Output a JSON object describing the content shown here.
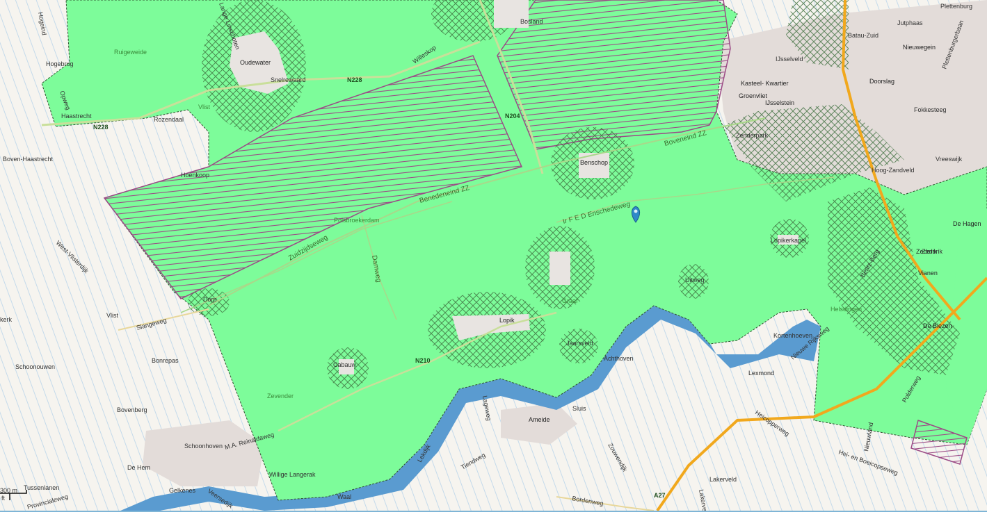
{
  "map": {
    "places": [
      {
        "name": "Hogeind"
      },
      {
        "name": "Hogebrug"
      },
      {
        "name": "Ruigeweide"
      },
      {
        "name": "Oudewater"
      },
      {
        "name": "Snelrewaard"
      },
      {
        "name": "Vlist"
      },
      {
        "name": "Haastrecht"
      },
      {
        "name": "Boven-Haastrecht"
      },
      {
        "name": "Rozendaal"
      },
      {
        "name": "Hoenkoop"
      },
      {
        "name": "Polsbroekerdam"
      },
      {
        "name": "Dorp"
      },
      {
        "name": "Vlist"
      },
      {
        "name": "Bonrepas"
      },
      {
        "name": "Schoonouwen"
      },
      {
        "name": "Bovenberg"
      },
      {
        "name": "Schoonhoven"
      },
      {
        "name": "De Hem"
      },
      {
        "name": "Tussenlanen"
      },
      {
        "name": "Gelkenes"
      },
      {
        "name": "Willige Langerak"
      },
      {
        "name": "Waal"
      },
      {
        "name": "Zevender"
      },
      {
        "name": "Cabauw"
      },
      {
        "name": "Lopik"
      },
      {
        "name": "Graaf"
      },
      {
        "name": "Jaarsveld"
      },
      {
        "name": "Benschop"
      },
      {
        "name": "Uitweg"
      },
      {
        "name": "Lopikerkapel"
      },
      {
        "name": "Achthoven"
      },
      {
        "name": "Ameide"
      },
      {
        "name": "Sluis"
      },
      {
        "name": "Lexmond"
      },
      {
        "name": "Kortenhoeven"
      },
      {
        "name": "Lakerveld"
      },
      {
        "name": "Helsdingen"
      },
      {
        "name": "Vianen"
      },
      {
        "name": "De Biezen"
      },
      {
        "name": "Zederik"
      },
      {
        "name": "De Hagen"
      },
      {
        "name": "Hoog-Zandveld"
      },
      {
        "name": "Vreeswijk"
      },
      {
        "name": "Zenderpark"
      },
      {
        "name": "IJsselstein"
      },
      {
        "name": "Groenvliet"
      },
      {
        "name": "Kasteel- Kwartier"
      },
      {
        "name": "IJsselveld"
      },
      {
        "name": "Batau-Zuid"
      },
      {
        "name": "Jutphaas"
      },
      {
        "name": "Plettenburg"
      },
      {
        "name": "Nieuwegein"
      },
      {
        "name": "Doorslag"
      },
      {
        "name": "Fokkesteeg"
      },
      {
        "name": "Bosland"
      },
      {
        "name": "Plettenburgerbaan"
      },
      {
        "name": "kerk"
      }
    ],
    "roads": [
      {
        "name": "N228"
      },
      {
        "name": "N228"
      },
      {
        "name": "N204"
      },
      {
        "name": "N210"
      },
      {
        "name": "A27"
      },
      {
        "name": "Benedeneind ZZ"
      },
      {
        "name": "Boveneind ZZ"
      },
      {
        "name": "Ir F E D Enschedeweg"
      },
      {
        "name": "Zuidzijdseweg"
      },
      {
        "name": "Damweg"
      },
      {
        "name": "Slangeweg"
      },
      {
        "name": "West-Vlisterdijk"
      },
      {
        "name": "M.A. Reinaldaweg"
      },
      {
        "name": "Lekdijk"
      },
      {
        "name": "Lageweg"
      },
      {
        "name": "Tiendweg"
      },
      {
        "name": "Zouwendijk"
      },
      {
        "name": "Bordenweg"
      },
      {
        "name": "Heicopperweg"
      },
      {
        "name": "Nieuwe Rijksweg"
      },
      {
        "name": "Hei- en Boeicopseweg"
      },
      {
        "name": "Nieuwland"
      },
      {
        "name": "Polderweg"
      },
      {
        "name": "Veersedijk"
      },
      {
        "name": "Provincialeweg"
      },
      {
        "name": "Willeskop"
      },
      {
        "name": "Lange Linschoten"
      },
      {
        "name": "Opweg"
      },
      {
        "name": "Zederik"
      },
      {
        "name": "Lakerveld"
      },
      {
        "name": "Bentz-Berg"
      }
    ],
    "scale": {
      "label": "300 m",
      "sub": "ft"
    },
    "colors": {
      "area": "#7dfc9a",
      "hatch": "#9b4b86",
      "river": "#4a8fc2",
      "water": "#a9d3f0"
    }
  }
}
